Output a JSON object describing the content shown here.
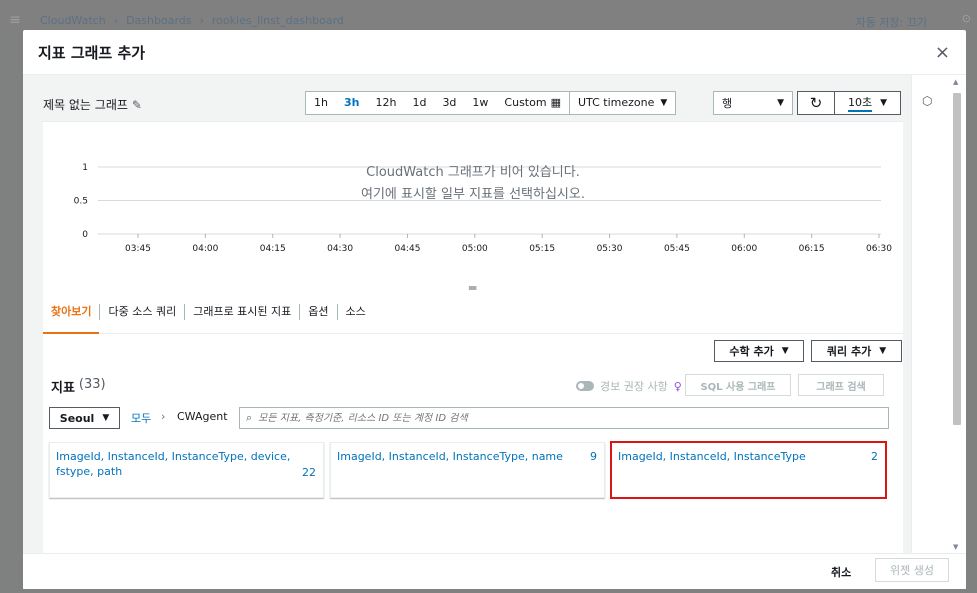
{
  "background": {
    "breadcrumb": [
      "CloudWatch",
      "Dashboards",
      "rookies_linst_dashboard"
    ],
    "right_text": "자동 저장: 끄기"
  },
  "modal": {
    "title": "지표 그래프 추가",
    "close_label": "×"
  },
  "graph": {
    "title": "제목 없는 그래프",
    "time_ranges": [
      "1h",
      "3h",
      "12h",
      "1d",
      "3d",
      "1w"
    ],
    "active_range": "3h",
    "custom_label": "Custom",
    "timezone_label": "UTC timezone",
    "view_type": "행",
    "interval": "10초",
    "empty_title": "CloudWatch 그래프가 비어 있습니다.",
    "empty_subtitle": "여기에 표시할 일부 지표를 선택하십시오."
  },
  "chart_data": {
    "type": "line",
    "x_ticks": [
      "03:45",
      "04:00",
      "04:15",
      "04:30",
      "04:45",
      "05:00",
      "05:15",
      "05:30",
      "05:45",
      "06:00",
      "06:15",
      "06:30"
    ],
    "y_ticks": [
      "0",
      "0.5",
      "1"
    ],
    "ylim": [
      0,
      1
    ],
    "series": []
  },
  "tabs": {
    "items": [
      "찾아보기",
      "다중 소스 쿼리",
      "그래프로 표시된 지표",
      "옵션",
      "소스"
    ],
    "active": 0,
    "math_label": "수학 추가",
    "query_label": "쿼리 추가"
  },
  "metrics": {
    "title": "지표",
    "count": "(33)",
    "toggle_label": "경보 권장 사항",
    "sql_button": "SQL 사용 그래프",
    "search_button": "그래프 검색",
    "region": "Seoul",
    "crumb_all": "모두",
    "crumb_namespace": "CWAgent",
    "search_placeholder": "모든 지표, 측정기준, 리소스 ID 또는 계정 ID 검색",
    "cards": [
      {
        "label": "ImageId, InstanceId, InstanceType, device, fstype, path",
        "count": "22"
      },
      {
        "label": "ImageId, InstanceId, InstanceType, name",
        "count": "9"
      },
      {
        "label": "ImageId, InstanceId, InstanceType",
        "count": "2"
      }
    ]
  },
  "footer": {
    "cancel_label": "취소",
    "create_label": "위젯 생성"
  }
}
